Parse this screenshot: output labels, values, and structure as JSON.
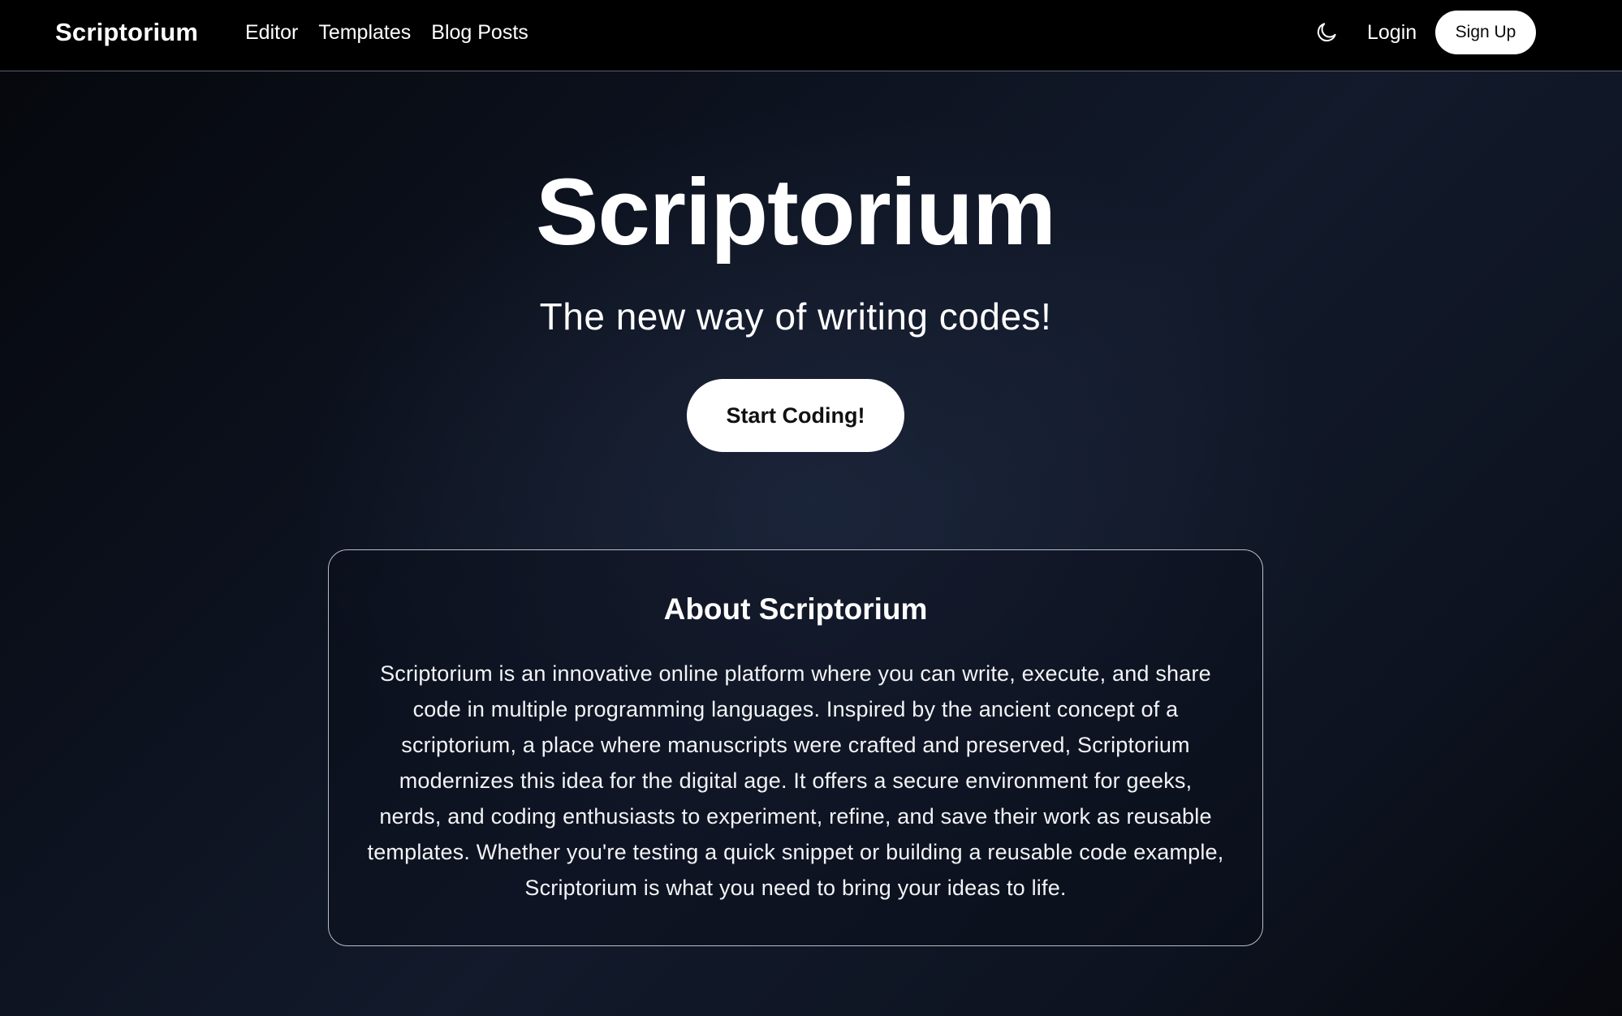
{
  "nav": {
    "brand": "Scriptorium",
    "links": [
      "Editor",
      "Templates",
      "Blog Posts"
    ],
    "theme_toggle_icon": "moon-icon",
    "login_label": "Login",
    "signup_label": "Sign Up"
  },
  "hero": {
    "title": "Scriptorium",
    "subtitle": "The new way of writing codes!",
    "cta_label": "Start Coding!"
  },
  "about": {
    "title": "About Scriptorium",
    "body": "Scriptorium is an innovative online platform where you can write, execute, and share code in multiple programming languages. Inspired by the ancient concept of a scriptorium, a place where manuscripts were crafted and preserved, Scriptorium modernizes this idea for the digital age. It offers a secure environment for geeks, nerds, and coding enthusiasts to experiment, refine, and save their work as reusable templates. Whether you're testing a quick snippet or building a reusable code example, Scriptorium is what you need to bring your ideas to life."
  },
  "colors": {
    "nav_background": "#000000",
    "button_background": "#ffffff",
    "button_text": "#111111",
    "page_background": "#0c111d",
    "card_border": "#b9bdc6"
  }
}
